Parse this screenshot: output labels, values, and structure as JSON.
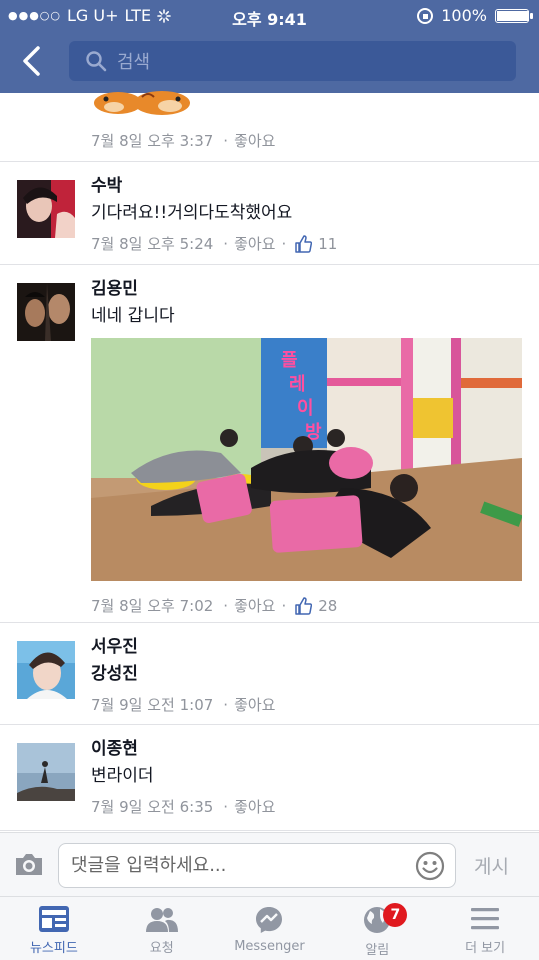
{
  "status_bar": {
    "signal": "●●●○○",
    "carrier": "LG U+",
    "network": "LTE",
    "time": "오후 9:41",
    "battery": "100%",
    "battery_level": 1.0
  },
  "header": {
    "search_placeholder": "검색"
  },
  "comments": [
    {
      "time": "7월 8일 오후 3:37",
      "like_label": "좋아요"
    },
    {
      "name": "수박",
      "text": "기다려요!!거의다도착했어요",
      "time": "7월 8일 오후 5:24",
      "like_label": "좋아요",
      "like_count": "11"
    },
    {
      "name": "김용민",
      "text": "네네 갑니다",
      "time": "7월 8일 오후 7:02",
      "like_label": "좋아요",
      "like_count": "28"
    },
    {
      "name": "서우진",
      "text": "강성진",
      "time": "7월 9일 오전 1:07",
      "like_label": "좋아요"
    },
    {
      "name": "이종현",
      "text": "변라이더",
      "time": "7월 9일 오전 6:35",
      "like_label": "좋아요"
    }
  ],
  "composer": {
    "placeholder": "댓글을 입력하세요...",
    "post_label": "게시"
  },
  "tabs": [
    {
      "label": "뉴스피드",
      "icon": "newsfeed-icon"
    },
    {
      "label": "요청",
      "icon": "friends-icon"
    },
    {
      "label": "Messenger",
      "icon": "messenger-icon"
    },
    {
      "label": "알림",
      "icon": "globe-icon",
      "badge": "7"
    },
    {
      "label": "더 보기",
      "icon": "menu-icon"
    }
  ],
  "colors": {
    "header": "#4e69a2",
    "accent": "#4267b2",
    "badge": "#e0191f"
  }
}
